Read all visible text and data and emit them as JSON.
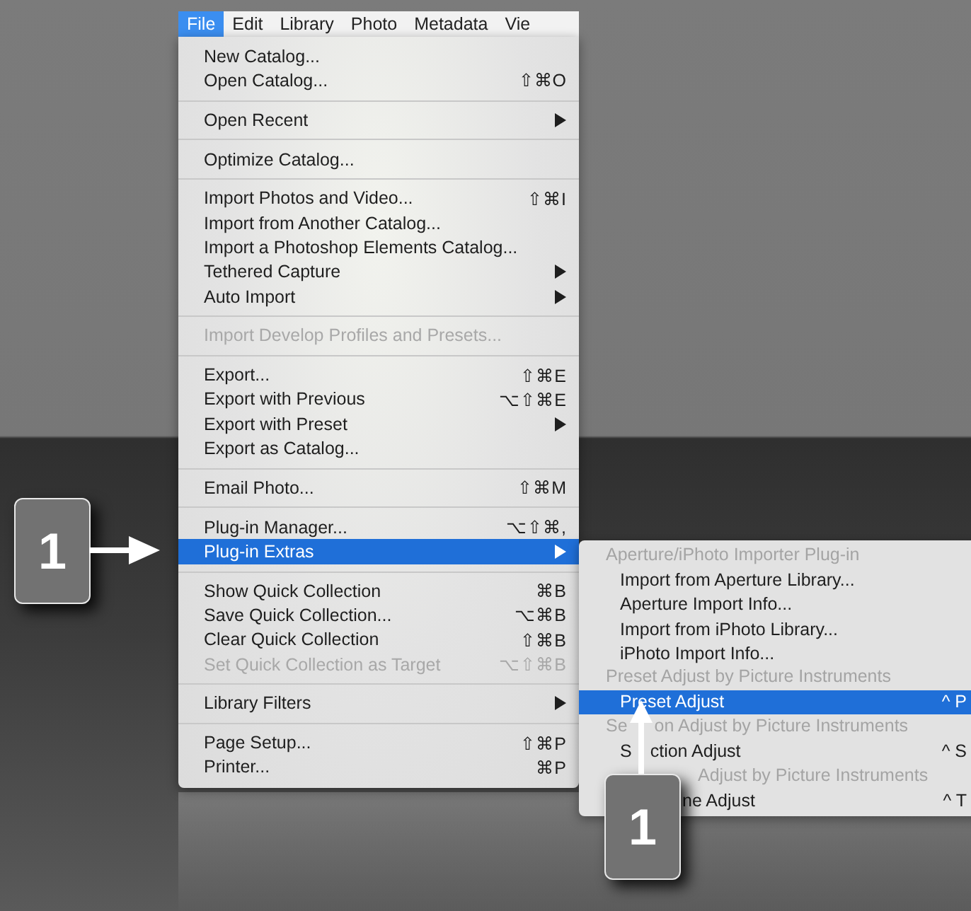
{
  "menubar": [
    {
      "label": "File",
      "selected": true
    },
    {
      "label": "Edit",
      "selected": false
    },
    {
      "label": "Library",
      "selected": false
    },
    {
      "label": "Photo",
      "selected": false
    },
    {
      "label": "Metadata",
      "selected": false
    },
    {
      "label": "Vie",
      "selected": false
    }
  ],
  "menu": {
    "sections": [
      [
        {
          "label": "New Catalog...",
          "disabled": false,
          "selected": false,
          "submenu": false
        },
        {
          "label": "Open Catalog...",
          "shortcut": "⇧⌘O",
          "disabled": false,
          "selected": false,
          "submenu": false
        }
      ],
      [
        {
          "label": "Open Recent",
          "disabled": false,
          "selected": false,
          "submenu": true
        }
      ],
      [
        {
          "label": "Optimize Catalog...",
          "disabled": false,
          "selected": false,
          "submenu": false
        }
      ],
      [
        {
          "label": "Import Photos and Video...",
          "shortcut": "⇧⌘I",
          "disabled": false,
          "selected": false,
          "submenu": false
        },
        {
          "label": "Import from Another Catalog...",
          "disabled": false,
          "selected": false,
          "submenu": false
        },
        {
          "label": "Import a Photoshop Elements Catalog...",
          "disabled": false,
          "selected": false,
          "submenu": false
        },
        {
          "label": "Tethered Capture",
          "disabled": false,
          "selected": false,
          "submenu": true
        },
        {
          "label": "Auto Import",
          "disabled": false,
          "selected": false,
          "submenu": true
        }
      ],
      [
        {
          "label": "Import Develop Profiles and Presets...",
          "disabled": true,
          "selected": false,
          "submenu": false
        }
      ],
      [
        {
          "label": "Export...",
          "shortcut": "⇧⌘E",
          "disabled": false,
          "selected": false,
          "submenu": false
        },
        {
          "label": "Export with Previous",
          "shortcut": "⌥⇧⌘E",
          "disabled": false,
          "selected": false,
          "submenu": false
        },
        {
          "label": "Export with Preset",
          "disabled": false,
          "selected": false,
          "submenu": true
        },
        {
          "label": "Export as Catalog...",
          "disabled": false,
          "selected": false,
          "submenu": false
        }
      ],
      [
        {
          "label": "Email Photo...",
          "shortcut": "⇧⌘M",
          "disabled": false,
          "selected": false,
          "submenu": false
        }
      ],
      [
        {
          "label": "Plug-in Manager...",
          "shortcut": "⌥⇧⌘,",
          "disabled": false,
          "selected": false,
          "submenu": false
        },
        {
          "label": "Plug-in Extras",
          "disabled": false,
          "selected": true,
          "submenu": true
        }
      ],
      [
        {
          "label": "Show Quick Collection",
          "shortcut": "⌘B",
          "disabled": false,
          "selected": false,
          "submenu": false
        },
        {
          "label": "Save Quick Collection...",
          "shortcut": "⌥⌘B",
          "disabled": false,
          "selected": false,
          "submenu": false
        },
        {
          "label": "Clear Quick Collection",
          "shortcut": "⇧⌘B",
          "disabled": false,
          "selected": false,
          "submenu": false
        },
        {
          "label": "Set Quick Collection as Target",
          "shortcut": "⌥⇧⌘B",
          "disabled": true,
          "selected": false,
          "submenu": false
        }
      ],
      [
        {
          "label": "Library Filters",
          "disabled": false,
          "selected": false,
          "submenu": true
        }
      ],
      [
        {
          "label": "Page Setup...",
          "shortcut": "⇧⌘P",
          "disabled": false,
          "selected": false,
          "submenu": false
        },
        {
          "label": "Printer...",
          "shortcut": "⌘P",
          "disabled": false,
          "selected": false,
          "submenu": false
        }
      ]
    ]
  },
  "submenu": {
    "items": [
      {
        "kind": "header",
        "parts": [
          "Aperture/iPhoto Importer Plug-in"
        ]
      },
      {
        "kind": "item",
        "parts": [
          "Import from Aperture Library..."
        ],
        "selected": false
      },
      {
        "kind": "item",
        "parts": [
          "Aperture Import Info..."
        ],
        "selected": false
      },
      {
        "kind": "item",
        "parts": [
          "Import from iPhoto Library..."
        ],
        "selected": false
      },
      {
        "kind": "item",
        "parts": [
          "iPhoto Import Info..."
        ],
        "selected": false
      },
      {
        "kind": "header",
        "parts": [
          "Preset Adjust by Picture Instruments"
        ]
      },
      {
        "kind": "item",
        "parts": [
          "Preset Adjust"
        ],
        "shortcut": "^ P",
        "selected": true
      },
      {
        "kind": "header",
        "parts": [
          "Se",
          "on Adjust by Picture Instruments"
        ]
      },
      {
        "kind": "item",
        "parts": [
          "S",
          "ction Adjust"
        ],
        "shortcut": "^ S",
        "selected": false
      },
      {
        "kind": "partial_header",
        "parts": [
          "Adjust by Picture Instruments"
        ]
      },
      {
        "kind": "partial",
        "parts": [
          "ne Adjust"
        ],
        "shortcut": "^ T",
        "selected": false
      }
    ]
  },
  "callouts": [
    {
      "label": "1"
    },
    {
      "label": "1"
    }
  ]
}
